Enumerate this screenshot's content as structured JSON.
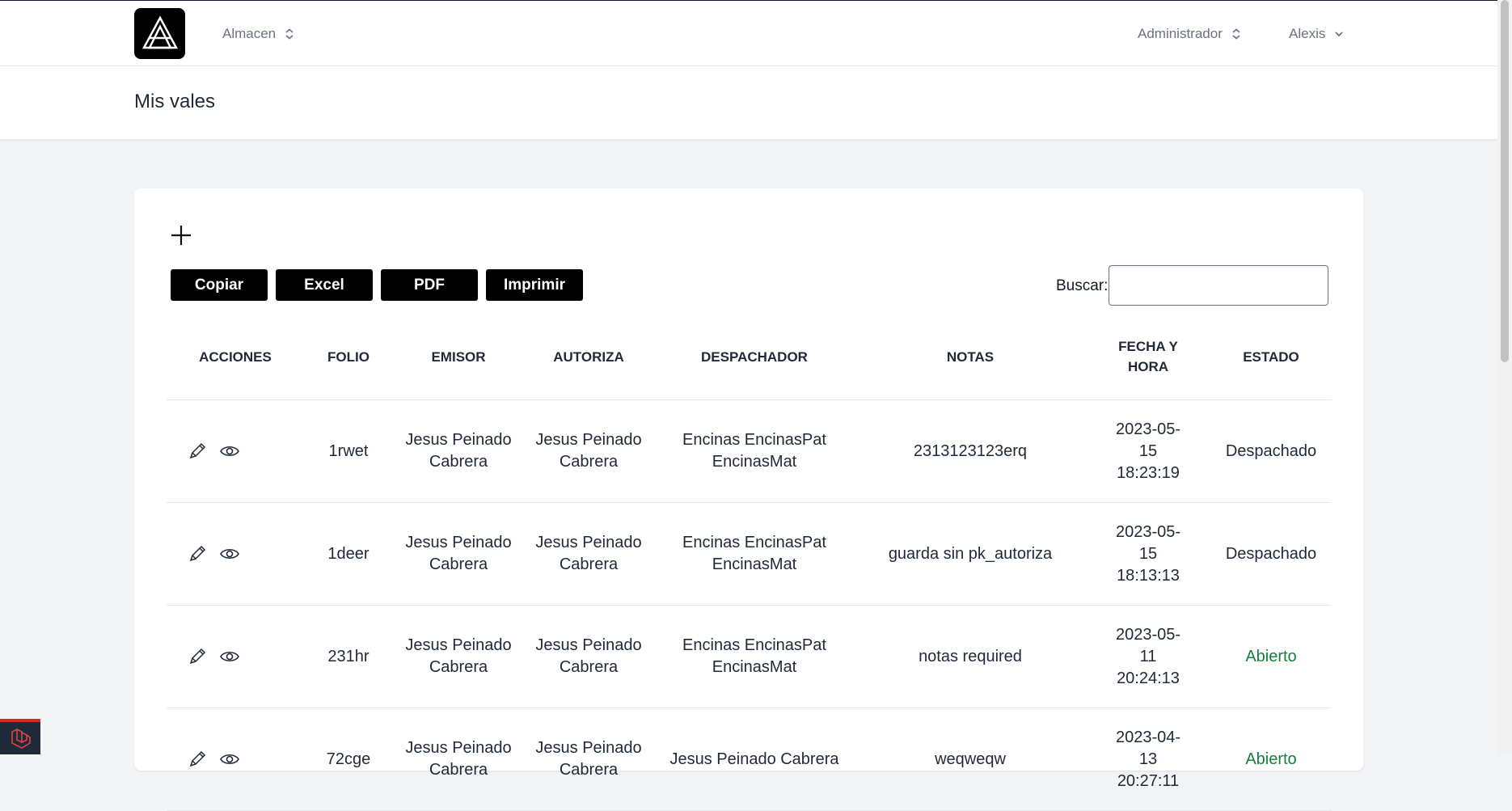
{
  "nav": {
    "warehouse_label": "Almacen",
    "role_label": "Administrador",
    "user_label": "Alexis"
  },
  "page": {
    "title": "Mis vales"
  },
  "toolbar": {
    "buttons": [
      {
        "label": "Copiar"
      },
      {
        "label": "Excel"
      },
      {
        "label": "PDF"
      },
      {
        "label": "Imprimir"
      }
    ],
    "search_label": "Buscar:",
    "search_value": ""
  },
  "table": {
    "headers": [
      "ACCIONES",
      "FOLIO",
      "EMISOR",
      "AUTORIZA",
      "DESPACHADOR",
      "NOTAS",
      "FECHA Y HORA",
      "ESTADO"
    ],
    "rows": [
      {
        "folio": "1rwet",
        "emisor": "Jesus Peinado Cabrera",
        "autoriza": "Jesus Peinado Cabrera",
        "despachador": "Encinas EncinasPat EncinasMat",
        "notas": "2313123123erq",
        "fecha": "2023-05-15 18:23:19",
        "estado": "Despachado"
      },
      {
        "folio": "1deer",
        "emisor": "Jesus Peinado Cabrera",
        "autoriza": "Jesus Peinado Cabrera",
        "despachador": "Encinas EncinasPat EncinasMat",
        "notas": "guarda sin pk_autoriza",
        "fecha": "2023-05-15 18:13:13",
        "estado": "Despachado"
      },
      {
        "folio": "231hr",
        "emisor": "Jesus Peinado Cabrera",
        "autoriza": "Jesus Peinado Cabrera",
        "despachador": "Encinas EncinasPat EncinasMat",
        "notas": "notas required",
        "fecha": "2023-05-11 20:24:13",
        "estado": "Abierto"
      },
      {
        "folio": "72cge",
        "emisor": "Jesus Peinado Cabrera",
        "autoriza": "Jesus Peinado Cabrera",
        "despachador": "Jesus Peinado Cabrera",
        "notas": "weqweqw",
        "fecha": "2023-04-13 20:27:11",
        "estado": "Abierto"
      }
    ]
  },
  "colors": {
    "accent": "#000000",
    "status_open": "#15803d",
    "background": "#f3f4f6"
  },
  "icons": [
    "logo-icon",
    "selector-icon",
    "chevron-down-icon",
    "plus-icon",
    "pencil-icon",
    "eye-icon",
    "laravel-icon"
  ]
}
